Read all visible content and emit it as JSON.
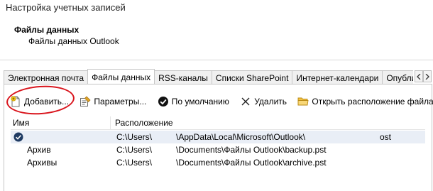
{
  "window": {
    "title": "Настройка учетных записей"
  },
  "header": {
    "title": "Файлы данных",
    "subtitle": "Файлы данных Outlook"
  },
  "tabs": [
    {
      "label": "Электронная почта",
      "active": false
    },
    {
      "label": "Файлы данных",
      "active": true
    },
    {
      "label": "RSS-каналы",
      "active": false
    },
    {
      "label": "Списки SharePoint",
      "active": false
    },
    {
      "label": "Интернет-календари",
      "active": false
    },
    {
      "label": "Опубликованные календари",
      "active": false
    }
  ],
  "toolbar": {
    "add": "Добавить...",
    "settings": "Параметры...",
    "default": "По умолчанию",
    "remove": "Удалить",
    "open_location": "Открыть расположение файла..."
  },
  "table": {
    "columns": {
      "name": "Имя",
      "location": "Расположение"
    },
    "rows": [
      {
        "name": "",
        "location": "C:\\Users\\",
        "location_mid": "\\AppData\\Local\\Microsoft\\Outlook\\",
        "location_tail": "ost",
        "default": true
      },
      {
        "name": "Архив",
        "location": "C:\\Users\\",
        "location_mid": "\\Documents\\Файлы Outlook\\backup.pst",
        "default": false
      },
      {
        "name": "Архивы",
        "location": "C:\\Users\\",
        "location_mid": "\\Documents\\Файлы Outlook\\archive.pst",
        "default": false
      }
    ]
  },
  "colors": {
    "highlight": "#d9141c",
    "selected_row": "#e9eef6",
    "check_icon": "#1f3b63"
  }
}
